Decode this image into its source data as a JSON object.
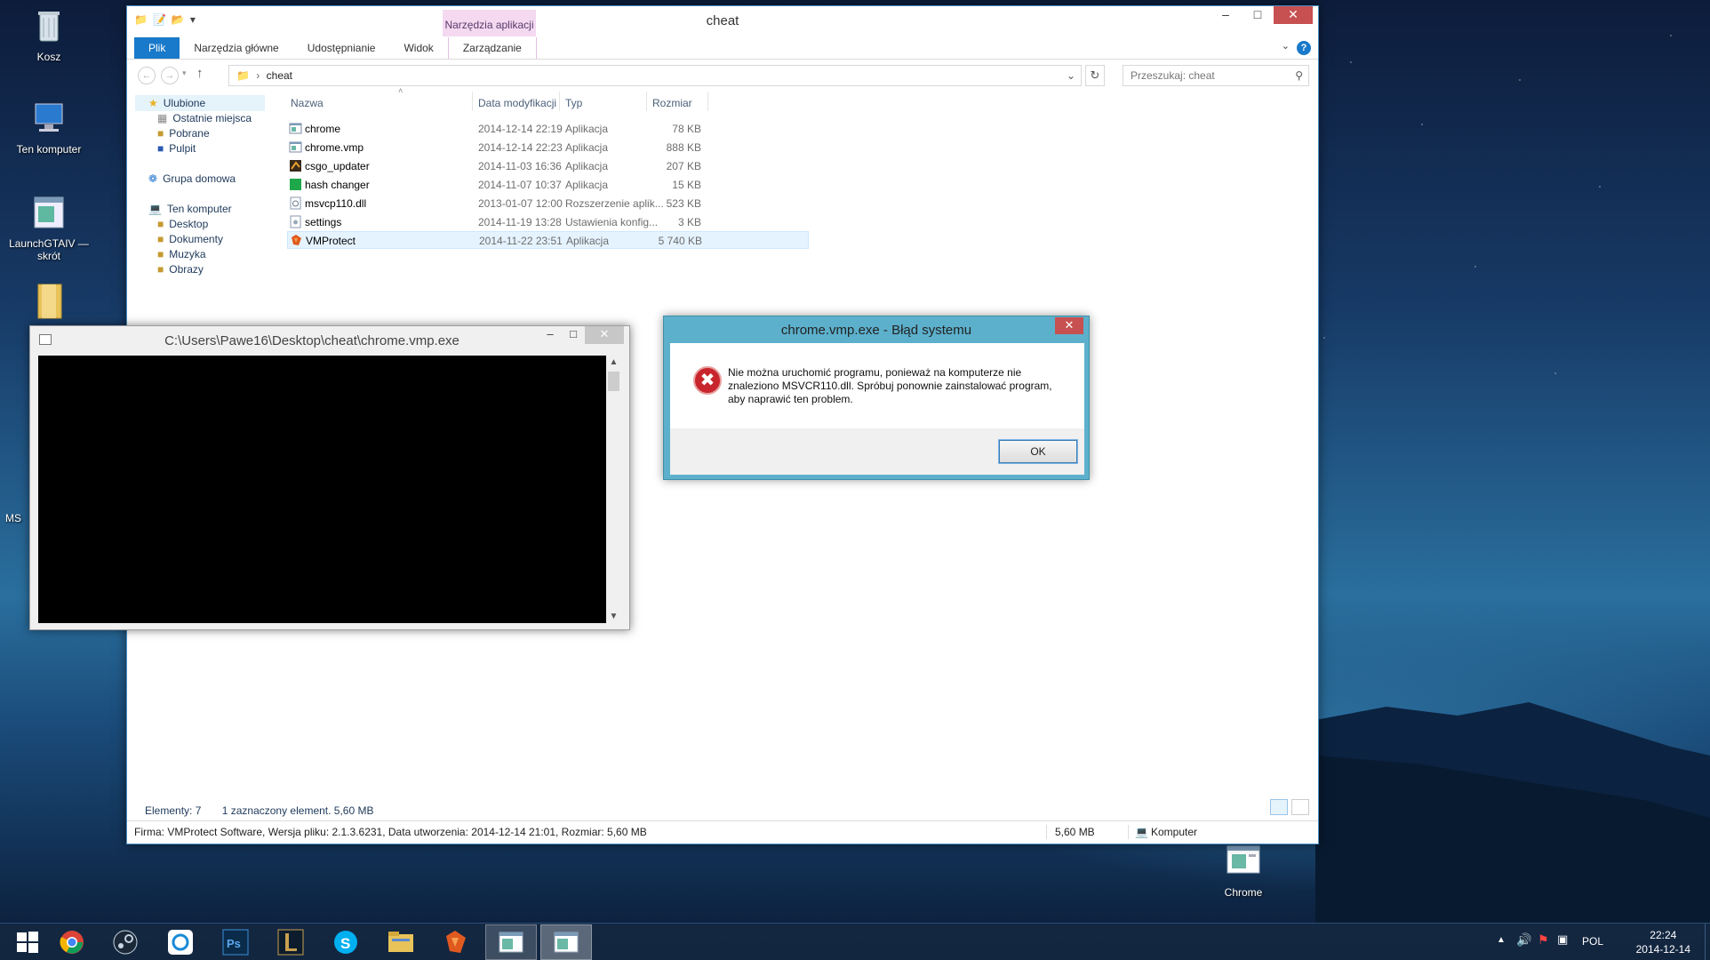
{
  "desktop": {
    "icons": [
      {
        "label": "Kosz"
      },
      {
        "label": "Ten komputer"
      },
      {
        "label": "LaunchGTAIV — skrót"
      },
      {
        "label": "Chrome"
      },
      {
        "label": "MS"
      }
    ]
  },
  "explorer": {
    "title": "cheat",
    "context_tab": "Narzędzia aplikacji",
    "ribbon_tabs": [
      "Plik",
      "Narzędzia główne",
      "Udostępnianie",
      "Widok",
      "Zarządzanie"
    ],
    "address": "cheat",
    "search_placeholder": "Przeszukaj: cheat",
    "nav": {
      "favorites": "Ulubione",
      "fav_items": [
        "Ostatnie miejsca",
        "Pobrane",
        "Pulpit"
      ],
      "homegroup": "Grupa domowa",
      "computer": "Ten komputer",
      "pc_items": [
        "Desktop",
        "Dokumenty",
        "Muzyka",
        "Obrazy"
      ]
    },
    "columns": {
      "name": "Nazwa",
      "date": "Data modyfikacji",
      "type": "Typ",
      "size": "Rozmiar"
    },
    "files": [
      {
        "name": "chrome",
        "date": "2014-12-14 22:19",
        "type": "Aplikacja",
        "size": "78 KB",
        "icon": "app-window-icon"
      },
      {
        "name": "chrome.vmp",
        "date": "2014-12-14 22:23",
        "type": "Aplikacja",
        "size": "888 KB",
        "icon": "app-window-icon"
      },
      {
        "name": "csgo_updater",
        "date": "2014-11-03 16:36",
        "type": "Aplikacja",
        "size": "207 KB",
        "icon": "csgo-icon"
      },
      {
        "name": "hash changer",
        "date": "2014-11-07 10:37",
        "type": "Aplikacja",
        "size": "15 KB",
        "icon": "green-square-icon"
      },
      {
        "name": "msvcp110.dll",
        "date": "2013-01-07 12:00",
        "type": "Rozszerzenie aplik...",
        "size": "523 KB",
        "icon": "dll-icon"
      },
      {
        "name": "settings",
        "date": "2014-11-19 13:28",
        "type": "Ustawienia konfig...",
        "size": "3 KB",
        "icon": "settings-file-icon"
      },
      {
        "name": "VMProtect",
        "date": "2014-11-22 23:51",
        "type": "Aplikacja",
        "size": "5 740 KB",
        "icon": "vmprotect-icon"
      }
    ],
    "status": {
      "count": "Elementy: 7",
      "selected": "1 zaznaczony element. 5,60 MB",
      "details": "Firma: VMProtect Software, Wersja pliku: 2.1.3.6231, Data utworzenia: 2014-12-14 21:01, Rozmiar: 5,60 MB",
      "size": "5,60 MB",
      "location": "Komputer"
    }
  },
  "console": {
    "title": "C:\\Users\\Pawe16\\Desktop\\cheat\\chrome.vmp.exe"
  },
  "dialog": {
    "title": "chrome.vmp.exe - Błąd systemu",
    "message": "Nie można uruchomić programu, ponieważ na komputerze nie znaleziono MSVCR110.dll. Spróbuj ponownie zainstalować program, aby naprawić ten problem.",
    "ok_label": "OK"
  },
  "taskbar": {
    "apps": [
      "chrome",
      "steam",
      "uplay",
      "photoshop",
      "league-of-legends",
      "skype",
      "file-explorer",
      "vmprotect",
      "app-window",
      "app-window-active"
    ],
    "language": "POL",
    "time": "22:24",
    "date": "2014-12-14"
  },
  "colors": {
    "accent": "#1979ca",
    "dialog_frame": "#5cb0cc",
    "close_red": "#c75050"
  }
}
